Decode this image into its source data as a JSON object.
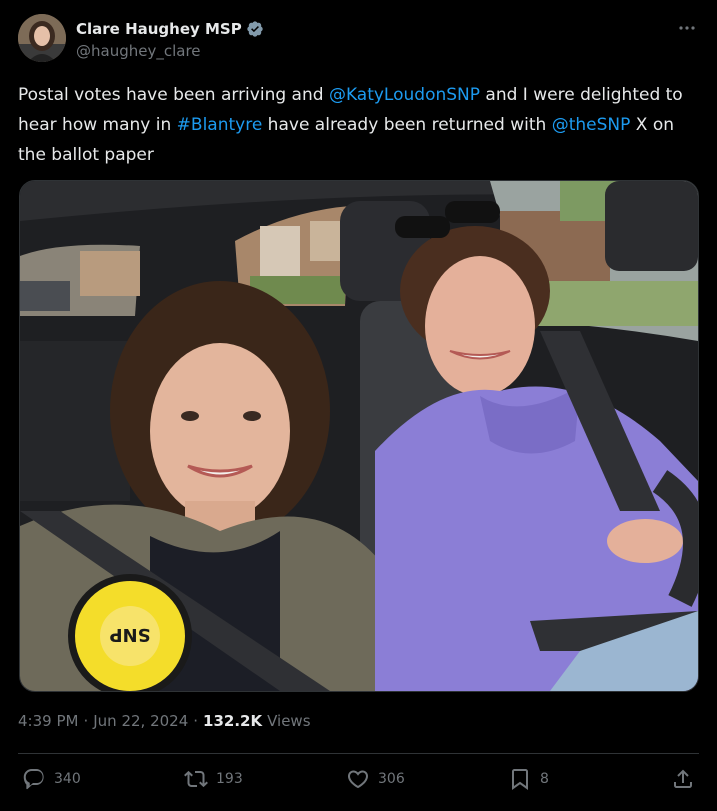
{
  "author": {
    "display_name": "Clare Haughey MSP",
    "handle": "@haughey_clare",
    "avatar_icon": "profile-avatar",
    "verified_icon": "verified-badge-icon"
  },
  "tweet": {
    "text_parts": [
      {
        "text": "Postal votes have been arriving and ",
        "type": "plain"
      },
      {
        "text": "@KatyLoudonSNP",
        "type": "mention"
      },
      {
        "text": " and I were delighted to hear how many in ",
        "type": "plain"
      },
      {
        "text": "#Blantyre",
        "type": "mention"
      },
      {
        "text": " have already been returned with ",
        "type": "plain"
      },
      {
        "text": "@theSNP",
        "type": "mention"
      },
      {
        "text": " X on the ballot paper",
        "type": "plain"
      }
    ],
    "photo_rosette_text": "SNP"
  },
  "meta": {
    "time": "4:39 PM",
    "separator": "·",
    "date": "Jun 22, 2024",
    "views_count": "132.2K",
    "views_label": "Views"
  },
  "actions": {
    "replies": "340",
    "reposts": "193",
    "likes": "306",
    "bookmarks": "8"
  },
  "colors": {
    "background": "#000000",
    "text": "#e7e9ea",
    "secondary": "#71767b",
    "accent": "#1d9bf0"
  }
}
